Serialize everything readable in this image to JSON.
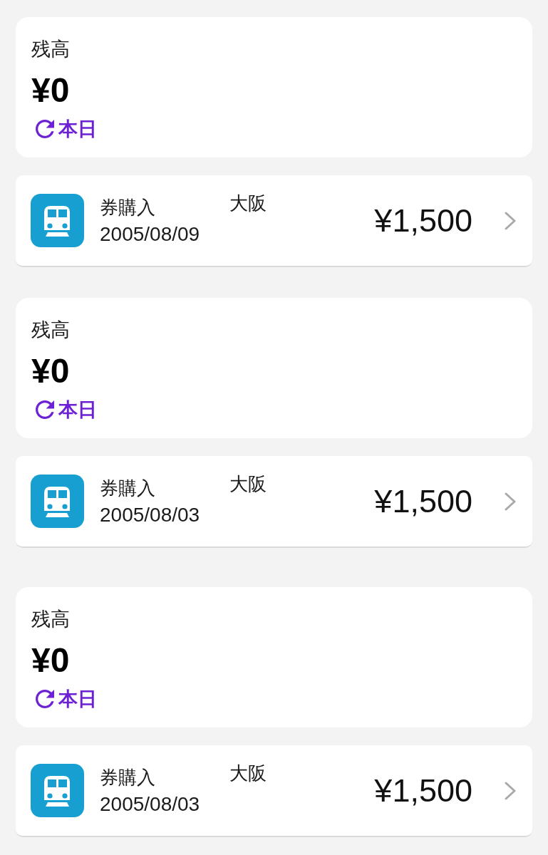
{
  "entries": [
    {
      "balance": {
        "label": "残高",
        "amount": "¥0",
        "refresh_label": "本日"
      },
      "transaction": {
        "type": "券購入",
        "date": "2005/08/09",
        "station": "大阪",
        "amount": "¥1,500"
      }
    },
    {
      "balance": {
        "label": "残高",
        "amount": "¥0",
        "refresh_label": "本日"
      },
      "transaction": {
        "type": "券購入",
        "date": "2005/08/03",
        "station": "大阪",
        "amount": "¥1,500"
      }
    },
    {
      "balance": {
        "label": "残高",
        "amount": "¥0",
        "refresh_label": "本日"
      },
      "transaction": {
        "type": "券購入",
        "date": "2005/08/03",
        "station": "大阪",
        "amount": "¥1,500"
      }
    }
  ]
}
